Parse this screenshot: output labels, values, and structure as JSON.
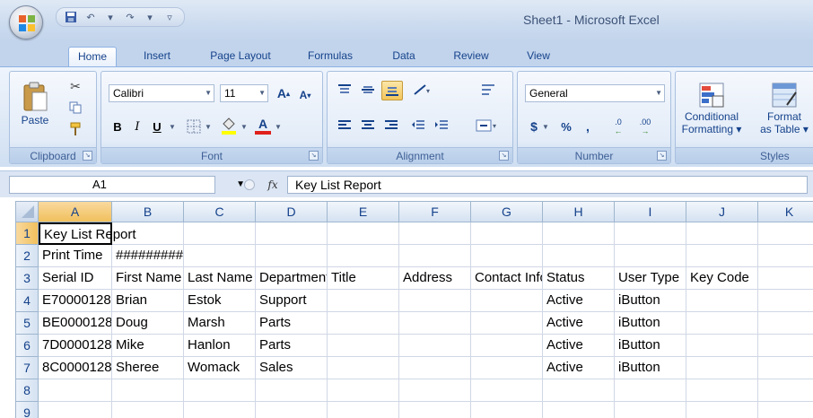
{
  "window": {
    "title": "Sheet1 - Microsoft Excel"
  },
  "ribbon": {
    "tabs": [
      "Home",
      "Insert",
      "Page Layout",
      "Formulas",
      "Data",
      "Review",
      "View"
    ],
    "active_tab": "Home",
    "clipboard": {
      "label": "Clipboard",
      "paste": "Paste"
    },
    "font": {
      "label": "Font",
      "name": "Calibri",
      "size": "11",
      "bold": "B",
      "italic": "I",
      "underline": "U",
      "grow": "A",
      "shrink": "A",
      "color": "A"
    },
    "alignment": {
      "label": "Alignment"
    },
    "number": {
      "label": "Number",
      "format": "General",
      "currency": "$",
      "percent": "%",
      "comma": ",",
      "inc_dec": ".00",
      "dec_dec": ".0"
    },
    "styles": {
      "label": "Styles",
      "conditional": [
        "Conditional",
        "Formatting"
      ],
      "format_table": [
        "Format",
        "as Table"
      ]
    }
  },
  "formula_bar": {
    "name_box": "A1",
    "fx": "fx",
    "content": "Key List Report"
  },
  "grid": {
    "columns": [
      "A",
      "B",
      "C",
      "D",
      "E",
      "F",
      "G",
      "H",
      "I",
      "J",
      "K"
    ],
    "rows": [
      "1",
      "2",
      "3",
      "4",
      "5",
      "6",
      "7",
      "8",
      "9"
    ],
    "cells": [
      [
        "Key List Report",
        "",
        "",
        "",
        "",
        "",
        "",
        "",
        "",
        "",
        ""
      ],
      [
        "Print Time",
        "#########",
        "",
        "",
        "",
        "",
        "",
        "",
        "",
        "",
        ""
      ],
      [
        "Serial ID",
        "First Name",
        "Last Name",
        "Department",
        "Title",
        "Address",
        "Contact Info",
        "Status",
        "User Type",
        "Key Code",
        ""
      ],
      [
        "E70000128",
        "Brian",
        "Estok",
        "Support",
        "",
        "",
        "",
        "Active",
        "iButton",
        "",
        ""
      ],
      [
        "BE0000128",
        "Doug",
        "Marsh",
        "Parts",
        "",
        "",
        "",
        "Active",
        "iButton",
        "",
        ""
      ],
      [
        "7D0000128",
        "Mike",
        "Hanlon",
        "Parts",
        "",
        "",
        "",
        "Active",
        "iButton",
        "",
        ""
      ],
      [
        "8C0000128",
        "Sheree",
        "Womack",
        "Sales",
        "",
        "",
        "",
        "Active",
        "iButton",
        "",
        ""
      ],
      [
        "",
        "",
        "",
        "",
        "",
        "",
        "",
        "",
        "",
        "",
        ""
      ],
      [
        "",
        "",
        "",
        "",
        "",
        "",
        "",
        "",
        "",
        "",
        ""
      ]
    ]
  },
  "colors": {
    "selected_header": "#f1c05c",
    "gridline": "#d0d7e5",
    "ribbon_text": "#15428b"
  }
}
